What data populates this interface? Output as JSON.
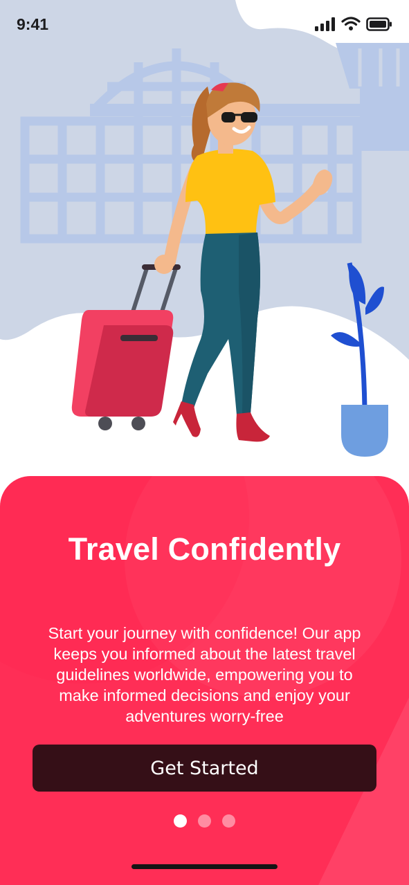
{
  "status_bar": {
    "time": "9:41"
  },
  "icons": {
    "signal": "cellular-signal-icon",
    "wifi": "wifi-icon",
    "battery": "battery-icon"
  },
  "colors": {
    "accent": "#ff2e56",
    "button": "#350f17",
    "sky": "#cdd6e6",
    "building": "#b7c8e8",
    "plant": "#1f4fd1",
    "pot": "#6e9ee0"
  },
  "onboarding": {
    "title": "Travel Confidently",
    "description": "Start your journey with confidence! Our app keeps you informed about the latest travel guidelines worldwide, empowering you to make informed decisions and enjoy your adventures worry-free",
    "cta_label": "Get Started",
    "page_count": 3,
    "current_page": 1
  }
}
